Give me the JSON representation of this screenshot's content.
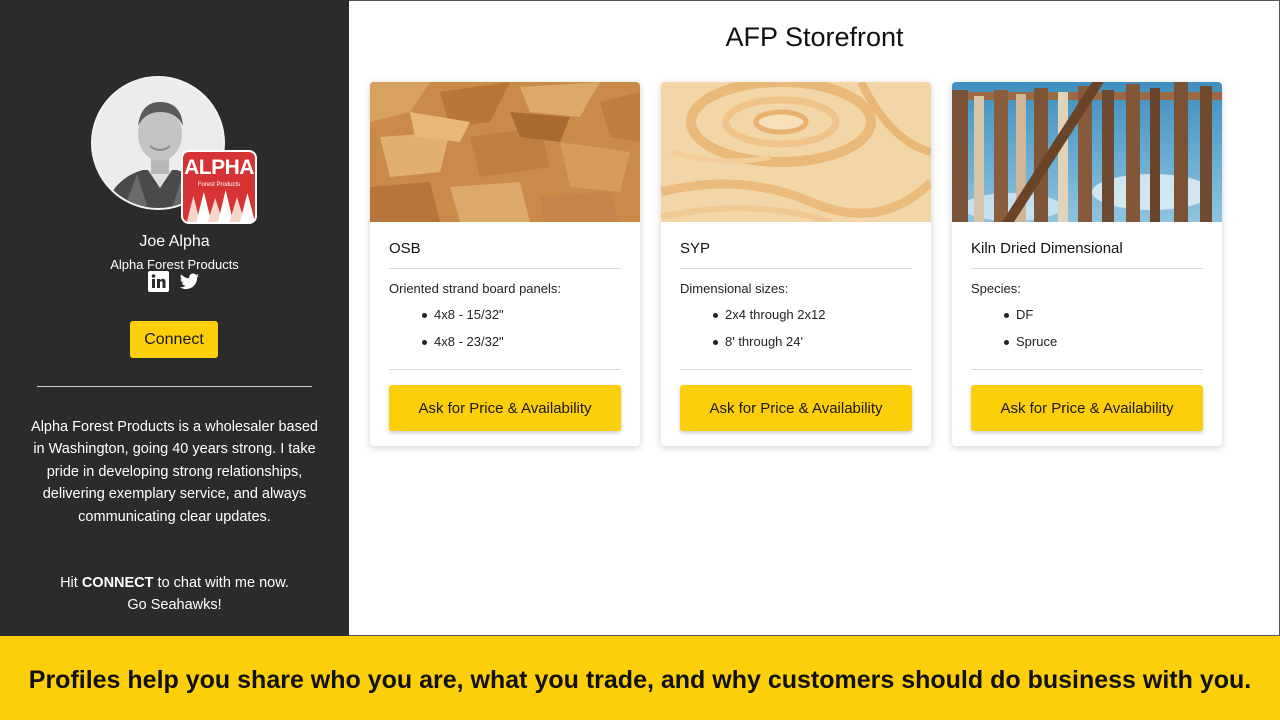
{
  "colors": {
    "sidebar_bg": "#2b2b2b",
    "accent_yellow": "#fccf0a",
    "logo_red": "#d63434"
  },
  "profile": {
    "name": "Joe Alpha",
    "company": "Alpha Forest Products",
    "logo_title": "ALPHA",
    "logo_subtitle": "Forest Products",
    "social_icons": [
      "linkedin-icon",
      "twitter-icon"
    ],
    "connect_label": "Connect",
    "bio": "Alpha Forest Products is a wholesaler based in Washington, going 40 years strong. I take pride in developing strong relationships, delivering exemplary service, and always communicating clear updates.",
    "hit_prefix": "Hit ",
    "hit_bold": "CONNECT",
    "hit_suffix": " to chat with me now.",
    "signoff": "Go Seahawks!"
  },
  "store": {
    "title": "AFP Storefront",
    "products": [
      {
        "title": "OSB",
        "label": "Oriented strand board panels:",
        "items": [
          "4x8 - 15/32\"",
          "4x8 - 23/32\""
        ],
        "button_label": "Ask for Price & Availability"
      },
      {
        "title": "SYP",
        "label": "Dimensional sizes:",
        "items": [
          "2x4 through 2x12",
          "8' through 24'"
        ],
        "button_label": "Ask for Price & Availability"
      },
      {
        "title": "Kiln Dried Dimensional",
        "label": "Species:",
        "items": [
          "DF",
          "Spruce"
        ],
        "button_label": "Ask for Price & Availability"
      }
    ]
  },
  "banner": {
    "text": "Profiles help you share who you are, what you trade, and why customers should do business with you."
  }
}
